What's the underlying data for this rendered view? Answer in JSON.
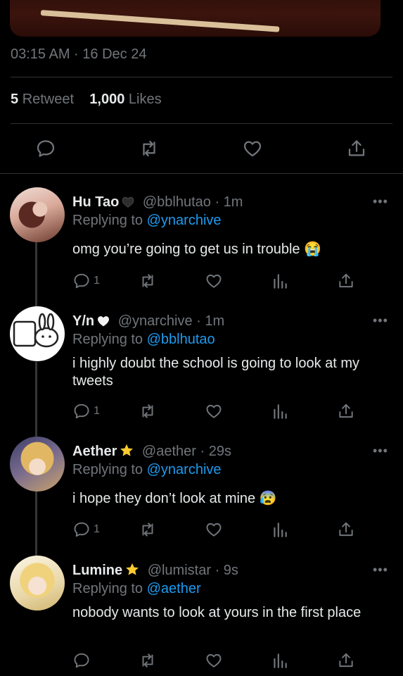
{
  "tweet": {
    "timestamp": "03:15 AM · 16 Dec 24",
    "retweets_count": "5",
    "retweets_label": "Retweet",
    "likes_count": "1,000",
    "likes_label": "Likes"
  },
  "colors": {
    "background": "#000000",
    "text": "#e7e9ea",
    "muted": "#71767b",
    "link": "#1d9bf0",
    "divider": "#2f3336"
  },
  "replies": [
    {
      "name": "Hu Tao",
      "badge": "black-heart-icon",
      "handle": "@bblhutao",
      "time": "· 1m",
      "replying_label": "Replying to",
      "replying_to": "@ynarchive",
      "text": "omg you’re going to get us in trouble 😭",
      "reply_count": "1"
    },
    {
      "name": "Y/n",
      "badge": "white-heart-icon",
      "handle": "@ynarchive",
      "time": "· 1m",
      "replying_label": "Replying to",
      "replying_to": "@bblhutao",
      "text": "i highly doubt the school is going to look at my tweets",
      "reply_count": "1"
    },
    {
      "name": "Aether",
      "badge": "star-icon",
      "handle": "@aether",
      "time": "· 29s",
      "replying_label": "Replying to",
      "replying_to": "@ynarchive",
      "text": "i hope they don’t look at mine 😰",
      "reply_count": "1"
    },
    {
      "name": "Lumine",
      "badge": "star-icon",
      "handle": "@lumistar",
      "time": "· 9s",
      "replying_label": "Replying to",
      "replying_to": "@aether",
      "text": "nobody wants to look at yours in the first place",
      "reply_count": ""
    }
  ]
}
